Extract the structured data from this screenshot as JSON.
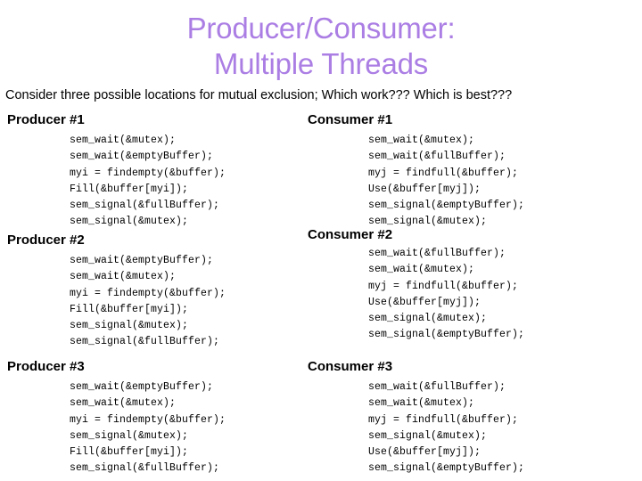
{
  "slide": {
    "title_lines": [
      "Producer/Consumer:",
      "Multiple Threads"
    ],
    "title_color": "#ab7ee4",
    "subtitle": "Consider three possible locations for mutual exclusion; Which work??? Which is best???",
    "body_color": "#000000",
    "background_color": "#ffffff"
  },
  "columns": {
    "left": {
      "sections": [
        {
          "heading": "Producer #1",
          "code": [
            "sem_wait(&mutex);",
            "sem_wait(&emptyBuffer);",
            "myi = findempty(&buffer);",
            "Fill(&buffer[myi]);",
            "sem_signal(&fullBuffer);",
            "sem_signal(&mutex);"
          ]
        },
        {
          "heading": "Producer #2",
          "code": [
            "sem_wait(&emptyBuffer);",
            "sem_wait(&mutex);",
            "myi = findempty(&buffer);",
            "Fill(&buffer[myi]);",
            "sem_signal(&mutex);",
            "sem_signal(&fullBuffer);"
          ]
        },
        {
          "heading": "Producer #3",
          "code": [
            "sem_wait(&emptyBuffer);",
            "sem_wait(&mutex);",
            "myi = findempty(&buffer);",
            "sem_signal(&mutex);",
            "Fill(&buffer[myi]);",
            "sem_signal(&fullBuffer);"
          ]
        }
      ]
    },
    "right": {
      "sections": [
        {
          "heading": "Consumer #1",
          "code": [
            "sem_wait(&mutex);",
            "sem_wait(&fullBuffer);",
            "myj = findfull(&buffer);",
            "Use(&buffer[myj]);",
            "sem_signal(&emptyBuffer);",
            "sem_signal(&mutex);"
          ]
        },
        {
          "heading": "Consumer #2",
          "code": [
            "sem_wait(&fullBuffer);",
            "sem_wait(&mutex);",
            "myj = findfull(&buffer);",
            "Use(&buffer[myj]);",
            "sem_signal(&mutex);",
            "sem_signal(&emptyBuffer);"
          ]
        },
        {
          "heading": "Consumer #3",
          "code": [
            "sem_wait(&fullBuffer);",
            "sem_wait(&mutex);",
            "myj = findfull(&buffer);",
            "sem_signal(&mutex);",
            "Use(&buffer[myj]);",
            "sem_signal(&emptyBuffer);"
          ]
        }
      ]
    }
  }
}
